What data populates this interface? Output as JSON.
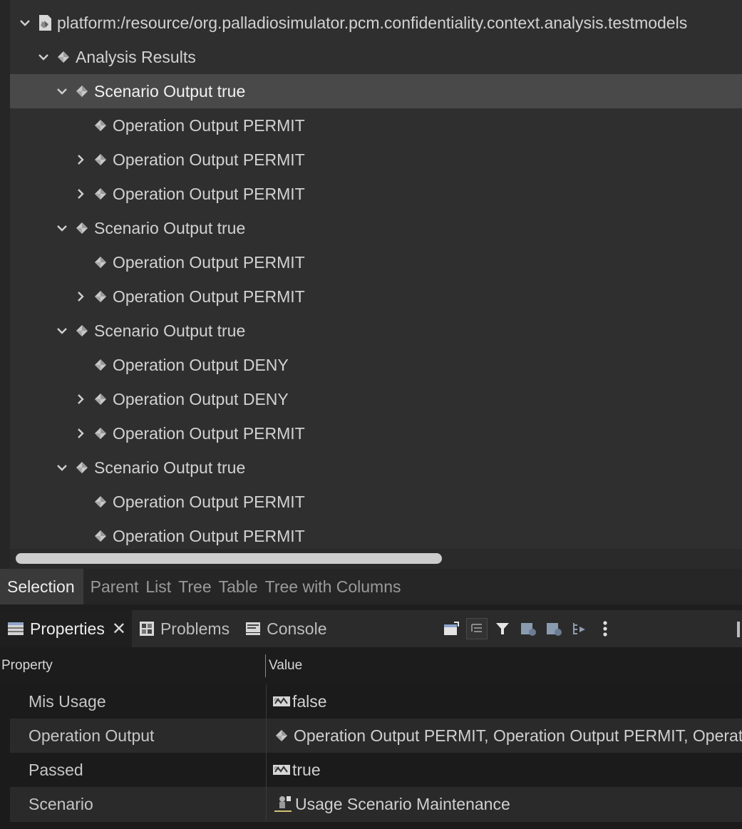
{
  "tree": {
    "rows": [
      {
        "label": "platform:/resource/org.palladiosimulator.pcm.confidentiality.context.analysis.testmodels",
        "icon": "resource-file-icon",
        "twisty": "expanded",
        "depth": 0
      },
      {
        "label": "Analysis Results",
        "icon": "model-element-icon",
        "twisty": "expanded",
        "depth": 1
      },
      {
        "label": "Scenario Output true",
        "icon": "model-element-icon",
        "twisty": "expanded",
        "depth": 2,
        "selected": true
      },
      {
        "label": "Operation Output PERMIT",
        "icon": "model-element-icon",
        "twisty": "none",
        "depth": 3
      },
      {
        "label": "Operation Output PERMIT",
        "icon": "model-element-icon",
        "twisty": "collapsed",
        "depth": 3
      },
      {
        "label": "Operation Output PERMIT",
        "icon": "model-element-icon",
        "twisty": "collapsed",
        "depth": 3
      },
      {
        "label": "Scenario Output true",
        "icon": "model-element-icon",
        "twisty": "expanded",
        "depth": 2
      },
      {
        "label": "Operation Output PERMIT",
        "icon": "model-element-icon",
        "twisty": "none",
        "depth": 3
      },
      {
        "label": "Operation Output PERMIT",
        "icon": "model-element-icon",
        "twisty": "collapsed",
        "depth": 3
      },
      {
        "label": "Scenario Output true",
        "icon": "model-element-icon",
        "twisty": "expanded",
        "depth": 2
      },
      {
        "label": "Operation Output DENY",
        "icon": "model-element-icon",
        "twisty": "none",
        "depth": 3
      },
      {
        "label": "Operation Output DENY",
        "icon": "model-element-icon",
        "twisty": "collapsed",
        "depth": 3
      },
      {
        "label": "Operation Output PERMIT",
        "icon": "model-element-icon",
        "twisty": "collapsed",
        "depth": 3
      },
      {
        "label": "Scenario Output true",
        "icon": "model-element-icon",
        "twisty": "expanded",
        "depth": 2
      },
      {
        "label": "Operation Output PERMIT",
        "icon": "model-element-icon",
        "twisty": "none",
        "depth": 3
      },
      {
        "label": "Operation Output PERMIT",
        "icon": "model-element-icon",
        "twisty": "none",
        "depth": 3
      }
    ]
  },
  "editor_tabs": [
    "Selection",
    "Parent",
    "List",
    "Tree",
    "Table",
    "Tree with Columns"
  ],
  "editor_active_tab": "Selection",
  "views": {
    "properties": "Properties",
    "problems": "Problems",
    "console": "Console",
    "close_glyph": "✕"
  },
  "toolbar": {
    "buttons": [
      "new-window-icon",
      "show-categories-icon",
      "filter-icon",
      "restore-default-icon",
      "advanced-icon",
      "pin-icon",
      "view-menu-icon"
    ]
  },
  "properties_table": {
    "header_property": "Property",
    "header_value": "Value",
    "rows": [
      {
        "name": "Mis Usage",
        "value": "false",
        "icon": "boolean-icon"
      },
      {
        "name": "Operation Output",
        "value": "Operation Output PERMIT, Operation Output PERMIT, Operation Output PERMIT",
        "icon": "model-element-icon"
      },
      {
        "name": "Passed",
        "value": "true",
        "icon": "boolean-icon"
      },
      {
        "name": "Scenario",
        "value": "Usage Scenario Maintenance",
        "icon": "usage-scenario-icon"
      }
    ]
  },
  "colors": {
    "tree_bg": "#2f2f2f",
    "selected_row": "#494949",
    "icon_diamond": "#c9c9c9"
  }
}
